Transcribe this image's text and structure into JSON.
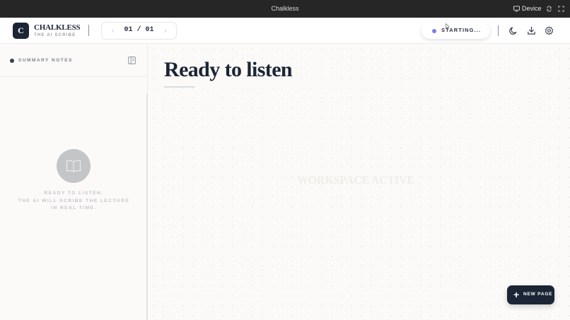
{
  "window": {
    "title": "Chalkless",
    "device_label": "Device"
  },
  "header": {
    "logo_letter": "C",
    "brand_name": "CHALKLESS",
    "brand_tagline": "THE AI SCRIBE",
    "page_counter": "01 / 01",
    "status_label": "STARTING...",
    "status_color": "#7c7fe8"
  },
  "sidebar": {
    "section_label": "SUMMARY NOTES",
    "empty_lines": [
      "READY TO LISTEN.",
      "THE AI WILL SCRIBE THE LECTURE",
      "IN REAL TIME."
    ]
  },
  "main": {
    "title": "Ready to listen",
    "watermark": "WORKSPACE ACTIVE",
    "new_page_label": "NEW PAGE"
  },
  "icons": {
    "device": "monitor-icon",
    "sync": "sync-icon",
    "fullscreen": "fullscreen-icon",
    "prev": "chevron-left-icon",
    "next": "chevron-right-icon",
    "theme": "moon-icon",
    "download": "download-icon",
    "settings": "gear-icon",
    "sidebar_toggle": "panel-icon",
    "empty_state": "book-open-icon",
    "add": "plus-icon"
  },
  "colors": {
    "brand_dark": "#1b2535",
    "window_bar": "#262626",
    "background": "#fbfaf8"
  }
}
